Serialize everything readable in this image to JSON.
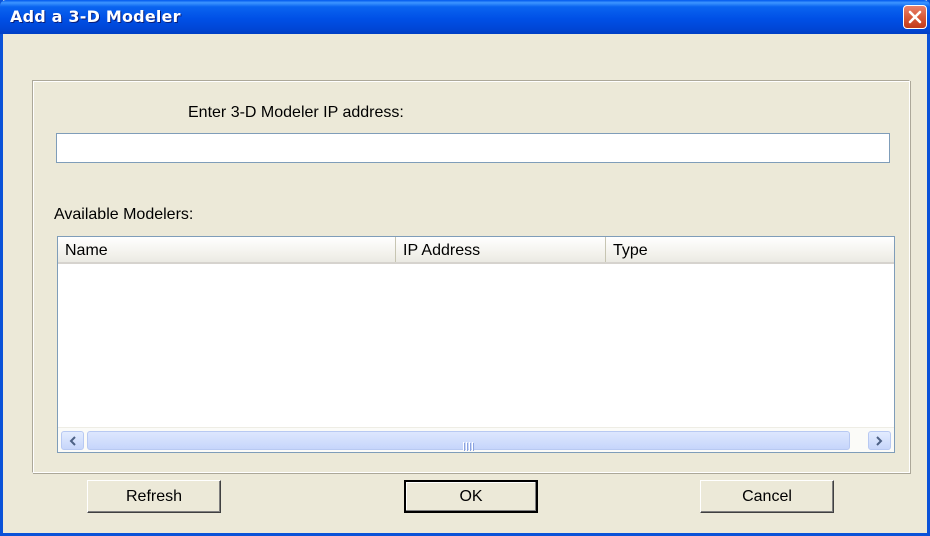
{
  "window": {
    "title": "Add a 3-D Modeler"
  },
  "form": {
    "ip_label": "Enter 3-D Modeler IP address:",
    "ip_value": "",
    "available_label": "Available Modelers:"
  },
  "table": {
    "columns": [
      "Name",
      "IP Address",
      "Type"
    ],
    "rows": []
  },
  "buttons": {
    "refresh": "Refresh",
    "ok": "OK",
    "cancel": "Cancel"
  },
  "icons": {
    "close": "close-icon",
    "scroll_left": "arrow-left-icon",
    "scroll_right": "arrow-right-icon"
  },
  "colors": {
    "titlebar": "#0050e6",
    "dialog_bg": "#ece9d8",
    "close_button": "#d85a3a"
  }
}
